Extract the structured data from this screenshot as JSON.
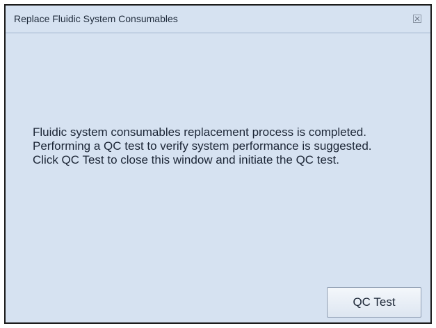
{
  "dialog": {
    "title": "Replace Fluidic System Consumables",
    "message": "Fluidic system consumables replacement process is completed. Performing a QC test to verify system performance is suggested. Click QC Test to close this window and initiate the QC test.",
    "close_icon": "close-icon",
    "qc_test_label": "QC Test"
  },
  "colors": {
    "window_background": "#d6e2f1",
    "border": "#1a1a1a",
    "text": "#1c2636"
  }
}
